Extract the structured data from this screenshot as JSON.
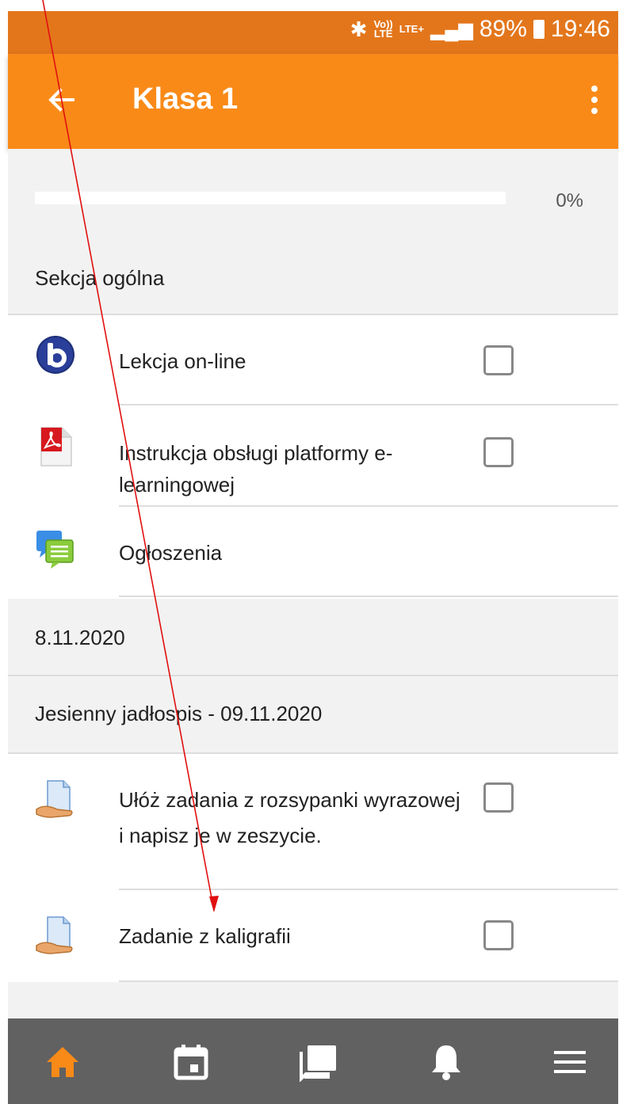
{
  "status_bar": {
    "net_top": "Vo))",
    "net_bottom": "LTE",
    "lte": "LTE+",
    "battery": "89%",
    "time": "19:46"
  },
  "app_bar": {
    "title": "Klasa 1",
    "back_icon": "arrow-left-icon",
    "menu_icon": "more-vertical-icon"
  },
  "progress": {
    "label": "0%",
    "value": 0
  },
  "sections": {
    "general": {
      "title": "Sekcja ogólna",
      "items": [
        {
          "label": "Lekcja on-line",
          "icon": "bigbluebutton-icon",
          "has_checkbox": true
        },
        {
          "label": "Instrukcja obsługi platformy e-learningowej",
          "icon": "pdf-icon",
          "has_checkbox": true
        },
        {
          "label": "Ogłoszenia",
          "icon": "forum-icon",
          "has_checkbox": false
        }
      ]
    },
    "date_section": {
      "title": "8.11.2020"
    },
    "autumn": {
      "title": "Jesienny jadłospis - 09.11.2020",
      "items": [
        {
          "label": "Ułóż zadania z rozsypanki wyrazowej i napisz je w zeszycie.",
          "icon": "assignment-icon",
          "has_checkbox": true
        },
        {
          "label": "Zadanie z kaligrafii",
          "icon": "assignment-icon",
          "has_checkbox": true
        }
      ]
    }
  },
  "bottom_nav": {
    "tabs": [
      "home-icon",
      "calendar-icon",
      "messages-icon",
      "notifications-icon",
      "menu-icon"
    ],
    "active_color": "#f98a18",
    "inactive_color": "#ffffff"
  },
  "colors": {
    "accent": "#f98a18",
    "status_bar": "#e3761b",
    "section_bg": "#f2f2f2",
    "nav_bg": "#616161"
  }
}
